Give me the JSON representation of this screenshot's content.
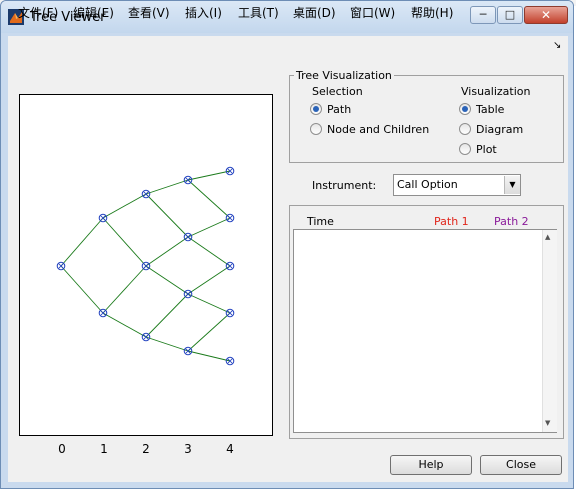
{
  "window": {
    "title": "Tree Viewer",
    "controls": {
      "minimize": "─",
      "maximize": "□",
      "close": "✕"
    }
  },
  "menu": {
    "items": [
      "文件(F)",
      "编辑(E)",
      "查看(V)",
      "插入(I)",
      "工具(T)",
      "桌面(D)",
      "窗口(W)",
      "帮助(H)"
    ],
    "dock_glyph": "↘"
  },
  "plot": {
    "x_ticks": [
      "0",
      "1",
      "2",
      "3",
      "4"
    ],
    "line_color": "#1a7a1a",
    "node_color": "#1f3fbf"
  },
  "tree_visualization": {
    "title": "Tree Visualization",
    "selection": {
      "heading": "Selection",
      "options": [
        {
          "label": "Path",
          "checked": true
        },
        {
          "label": "Node and Children",
          "checked": false
        }
      ]
    },
    "visualization": {
      "heading": "Visualization",
      "options": [
        {
          "label": "Table",
          "checked": true
        },
        {
          "label": "Diagram",
          "checked": false
        },
        {
          "label": "Plot",
          "checked": false
        }
      ]
    }
  },
  "instrument": {
    "label": "Instrument:",
    "value": "Call Option",
    "arrow": "▼"
  },
  "table": {
    "headers": {
      "time": "Time",
      "path1": "Path 1",
      "path2": "Path 2"
    },
    "scroll_up": "▲",
    "scroll_down": "▼"
  },
  "buttons": {
    "help": "Help",
    "close": "Close"
  }
}
